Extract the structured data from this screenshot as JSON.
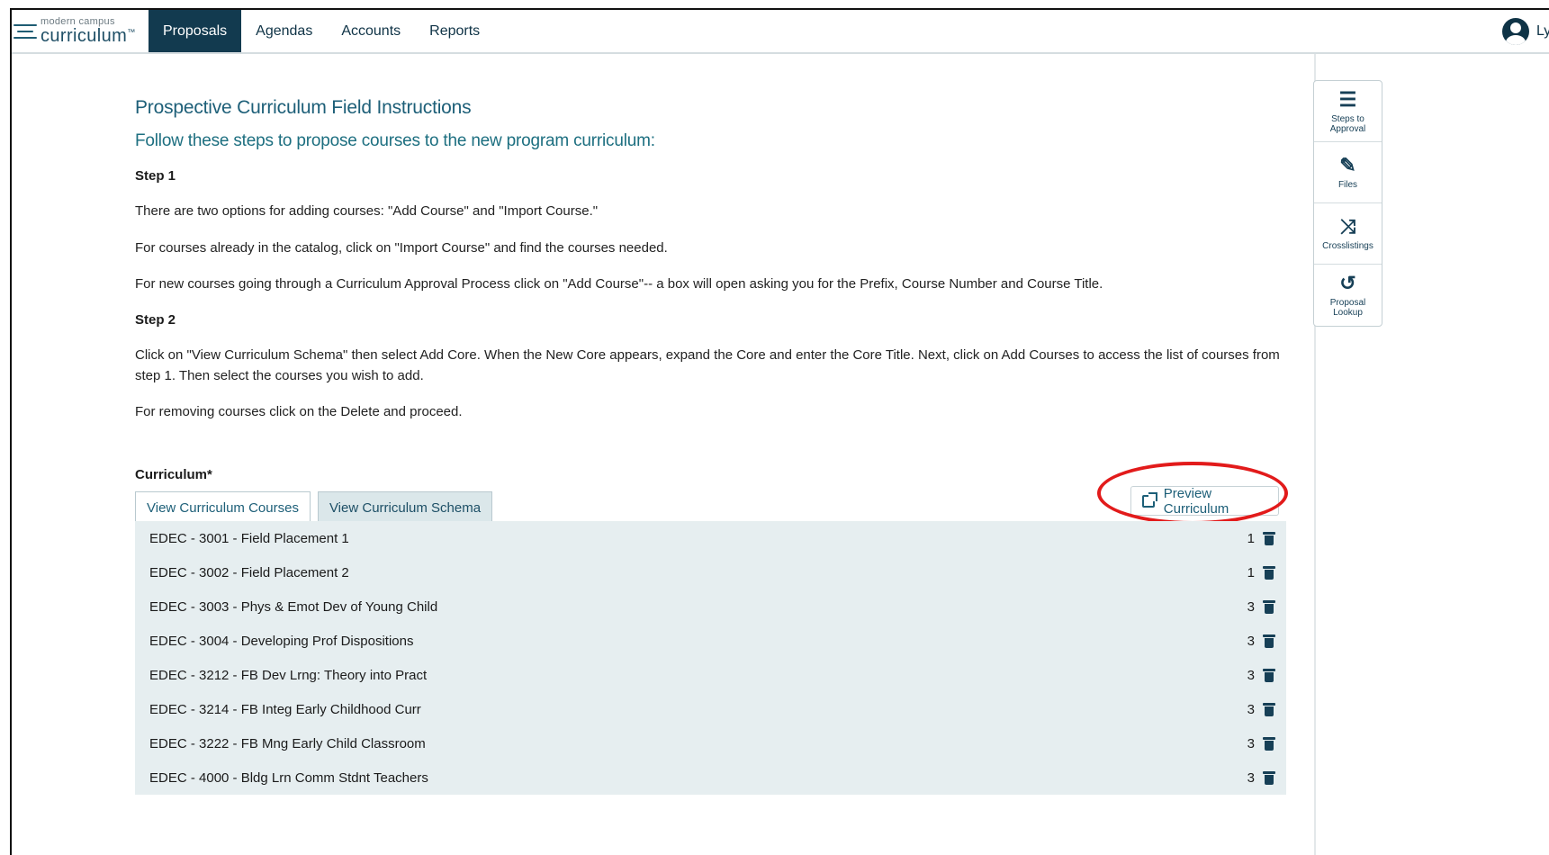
{
  "app": {
    "logo_small": "modern campus",
    "logo_big": "curriculum",
    "logo_tm": "™"
  },
  "nav": {
    "items": [
      {
        "label": "Proposals",
        "active": true
      },
      {
        "label": "Agendas",
        "active": false
      },
      {
        "label": "Accounts",
        "active": false
      },
      {
        "label": "Reports",
        "active": false
      }
    ],
    "user_name": "Ly"
  },
  "instructions": {
    "title": "Prospective Curriculum Field Instructions",
    "subtitle": "Follow these steps to propose courses to the new program curriculum:",
    "step1_heading": "Step 1",
    "step1_p1": "There are two options for adding courses: \"Add Course\" and \"Import Course.\"",
    "step1_p2": "For courses already in the catalog, click on \"Import Course\" and find the courses needed.",
    "step1_p3": "For new courses going through a Curriculum Approval Process click on \"Add Course\"-- a box will open asking you for the Prefix, Course Number and Course Title.",
    "step2_heading": "Step 2",
    "step2_p1": "Click on \"View Curriculum Schema\" then select Add Core. When the New Core appears, expand the Core and enter the Core Title. Next, click on Add Courses to access the list of courses from step 1. Then select the courses you wish to add.",
    "step2_p2": "For removing courses click on the Delete and proceed."
  },
  "curriculum": {
    "label": "Curriculum*",
    "preview_button": "Preview Curriculum",
    "tabs": [
      {
        "label": "View Curriculum Courses",
        "active": true
      },
      {
        "label": "View Curriculum Schema",
        "active": false
      }
    ],
    "courses": [
      {
        "name": "EDEC - 3001 - Field Placement 1",
        "credits": "1"
      },
      {
        "name": "EDEC - 3002 - Field Placement 2",
        "credits": "1"
      },
      {
        "name": "EDEC - 3003 - Phys & Emot Dev of Young Child",
        "credits": "3"
      },
      {
        "name": "EDEC - 3004 - Developing Prof Dispositions",
        "credits": "3"
      },
      {
        "name": "EDEC - 3212 - FB Dev Lrng: Theory into Pract",
        "credits": "3"
      },
      {
        "name": "EDEC - 3214 - FB Integ Early Childhood Curr",
        "credits": "3"
      },
      {
        "name": "EDEC - 3222 - FB Mng Early Child Classroom",
        "credits": "3"
      },
      {
        "name": "EDEC - 4000 - Bldg Lrn Comm Stdnt Teachers",
        "credits": "3"
      }
    ]
  },
  "side_panel": {
    "items": [
      {
        "label": "Steps to Approval",
        "icon": "list-icon",
        "glyph": "☰"
      },
      {
        "label": "Files",
        "icon": "paperclip-icon",
        "glyph": "✎"
      },
      {
        "label": "Crosslistings",
        "icon": "shuffle-icon",
        "glyph": "⤨"
      },
      {
        "label": "Proposal Lookup",
        "icon": "history-icon",
        "glyph": "↺"
      }
    ]
  },
  "colors": {
    "nav_active_bg": "#123a4f",
    "heading_teal": "#1d5f78",
    "list_bg": "#e6eef0",
    "highlight_ring": "#e21b1b"
  }
}
